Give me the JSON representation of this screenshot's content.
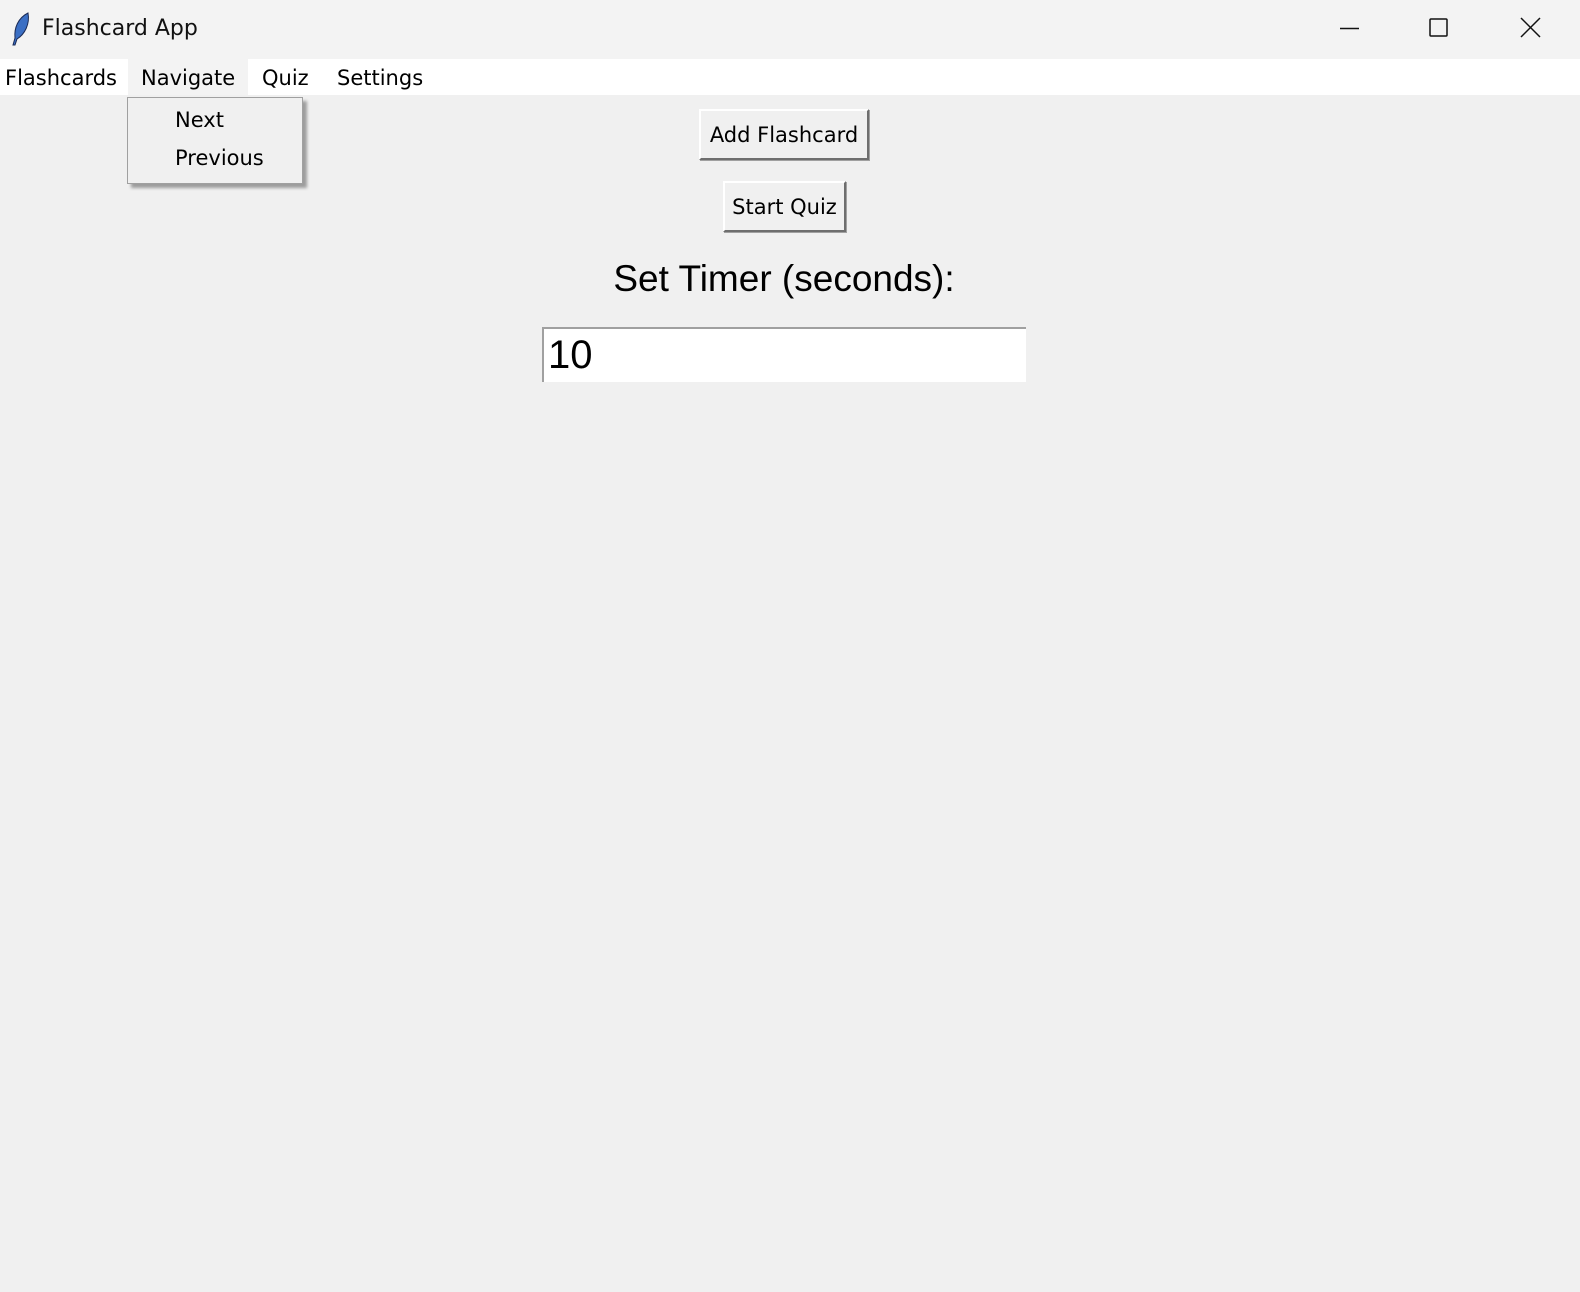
{
  "window": {
    "title": "Flashcard App",
    "icon": "feather-icon"
  },
  "menubar": {
    "items": [
      {
        "label": "Flashcards"
      },
      {
        "label": "Navigate"
      },
      {
        "label": "Quiz"
      },
      {
        "label": "Settings"
      }
    ]
  },
  "navigate_menu": {
    "items": [
      {
        "label": "Next"
      },
      {
        "label": "Previous"
      }
    ]
  },
  "main": {
    "add_flashcard_label": "Add Flashcard",
    "start_quiz_label": "Start Quiz",
    "timer_label": "Set Timer (seconds):",
    "timer_value": "10"
  }
}
